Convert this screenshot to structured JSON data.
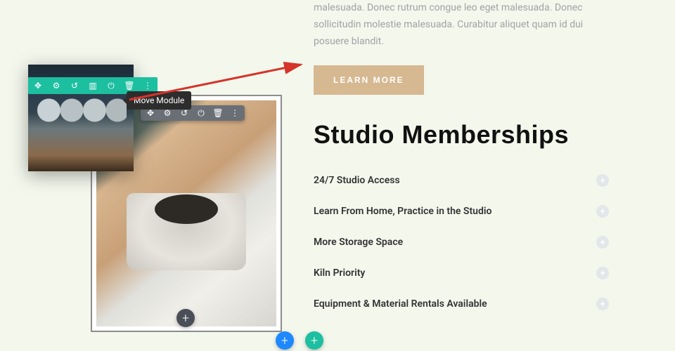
{
  "intro": {
    "text": "malesuada. Donec rutrum congue leo eget malesuada. Donec sollicitudin molestie malesuada. Curabitur aliquet quam id dui posuere blandit.",
    "cta_label": "LEARN MORE"
  },
  "heading": "Studio Memberships",
  "accordion": [
    {
      "label": "24/7 Studio Access"
    },
    {
      "label": "Learn From Home, Practice in the Studio"
    },
    {
      "label": "More Storage Space"
    },
    {
      "label": "Kiln Priority"
    },
    {
      "label": "Equipment & Material Rentals Available"
    }
  ],
  "tooltip": "Move Module",
  "icons": {
    "move": "✥",
    "gear": "⚙",
    "undo": "↺",
    "columns": "▥",
    "power": "⏻",
    "trash": "🗑",
    "more": "⋮",
    "plus": "+"
  }
}
